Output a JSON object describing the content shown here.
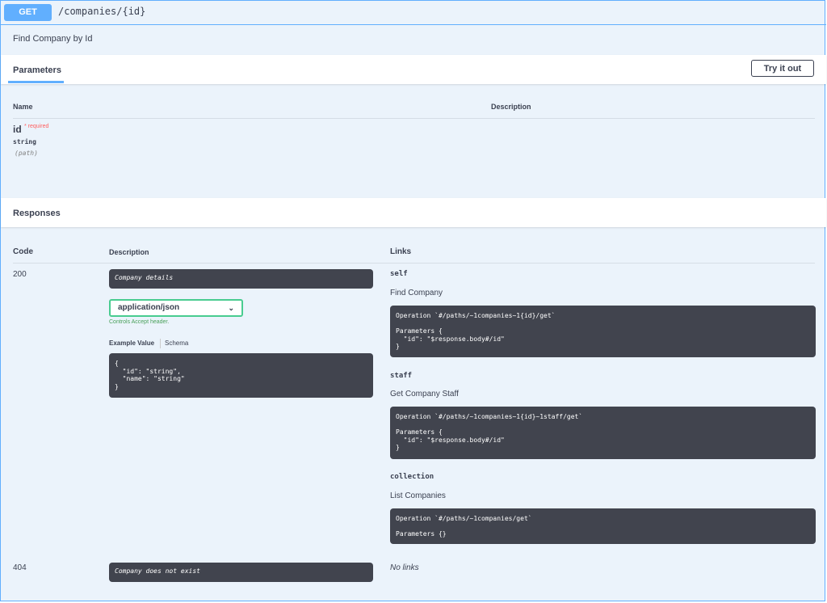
{
  "operation": {
    "method": "GET",
    "path": "/companies/{id}",
    "summary": "Find Company by Id"
  },
  "parameters": {
    "tab_label": "Parameters",
    "try_label": "Try it out",
    "col_name": "Name",
    "col_description": "Description",
    "items": [
      {
        "name": "id",
        "required": "* required",
        "type": "string",
        "in": "(path)"
      }
    ]
  },
  "responses": {
    "title": "Responses",
    "col_code": "Code",
    "col_description": "Description",
    "col_links": "Links",
    "items": [
      {
        "code": "200",
        "description": "Company details",
        "media_type": "application/json",
        "controls_text": "Controls Accept header.",
        "example_label": "Example Value",
        "schema_label": "Schema",
        "example": "{\n  \"id\": \"string\",\n  \"name\": \"string\"\n}",
        "links": [
          {
            "name": "self",
            "description": "Find Company",
            "code": "Operation `#/paths/~1companies~1{id}/get`\n\nParameters {\n  \"id\": \"$response.body#/id\"\n}"
          },
          {
            "name": "staff",
            "description": "Get Company Staff",
            "code": "Operation `#/paths/~1companies~1{id}~1staff/get`\n\nParameters {\n  \"id\": \"$response.body#/id\"\n}"
          },
          {
            "name": "collection",
            "description": "List Companies",
            "code": "Operation `#/paths/~1companies/get`\n\nParameters {}"
          }
        ]
      },
      {
        "code": "404",
        "description": "Company does not exist",
        "no_links": "No links"
      }
    ]
  },
  "colors": {
    "get_blue": "#61affe",
    "green": "#49cc90",
    "dark": "#41444e",
    "required": "#ff6060"
  },
  "icons": {
    "select_arrow": "chevron-down-icon"
  }
}
